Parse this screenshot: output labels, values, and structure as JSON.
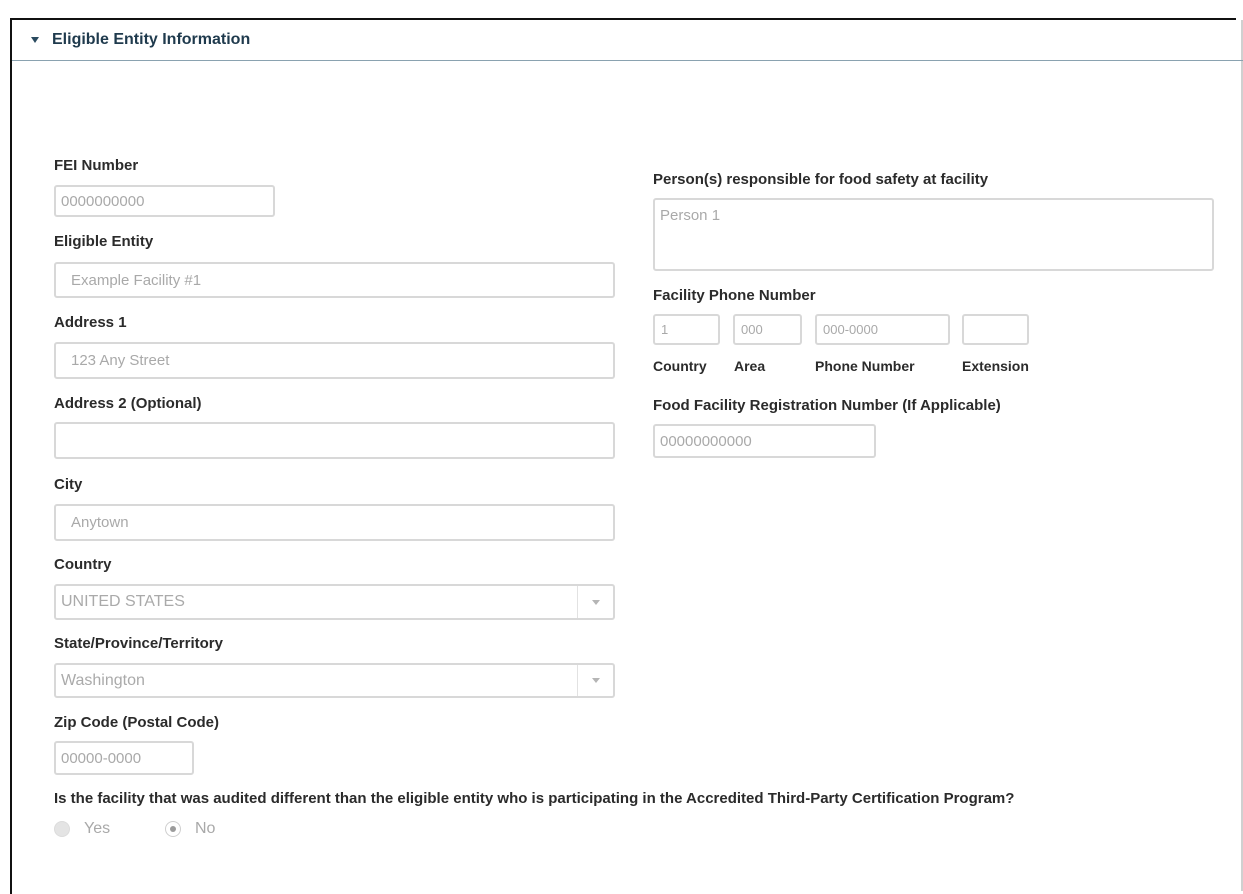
{
  "section": {
    "title": "Eligible Entity Information"
  },
  "left": {
    "fei_number": {
      "label": "FEI Number",
      "value": "0000000000"
    },
    "eligible_entity": {
      "label": "Eligible Entity",
      "value": "Example Facility #1"
    },
    "address1": {
      "label": "Address 1",
      "value": "123 Any Street"
    },
    "address2": {
      "label": "Address 2 (Optional)",
      "value": ""
    },
    "city": {
      "label": "City",
      "value": "Anytown"
    },
    "country": {
      "label": "Country",
      "value": "UNITED STATES"
    },
    "state": {
      "label": "State/Province/Territory",
      "value": "Washington"
    },
    "zip": {
      "label": "Zip Code (Postal Code)",
      "value": "00000-0000"
    }
  },
  "right": {
    "responsible": {
      "label": "Person(s) responsible for food safety at facility",
      "value": "Person 1"
    },
    "phone": {
      "label": "Facility Phone Number",
      "country_value": "1",
      "area_value": "000",
      "number_value": "000-0000",
      "extension_value": "",
      "country_label": "Country",
      "area_label": "Area",
      "number_label": "Phone Number",
      "extension_label": "Extension"
    },
    "ffr": {
      "label": "Food Facility Registration Number (If Applicable)",
      "value": "00000000000"
    }
  },
  "audit_question": {
    "text": "Is the facility that was audited different than the eligible entity who is participating in the Accredited Third-Party Certification Program?",
    "options": [
      {
        "label": "Yes",
        "selected": false
      },
      {
        "label": "No",
        "selected": true
      }
    ]
  },
  "colors": {
    "header_text": "#1f3a4d",
    "header_border": "#8aa2b0",
    "field_border": "#d8d8d8",
    "placeholder_text": "#a9a9a9"
  },
  "icons": {
    "section_toggle": "caret-down-icon",
    "select_toggle": "chevron-down-icon"
  }
}
